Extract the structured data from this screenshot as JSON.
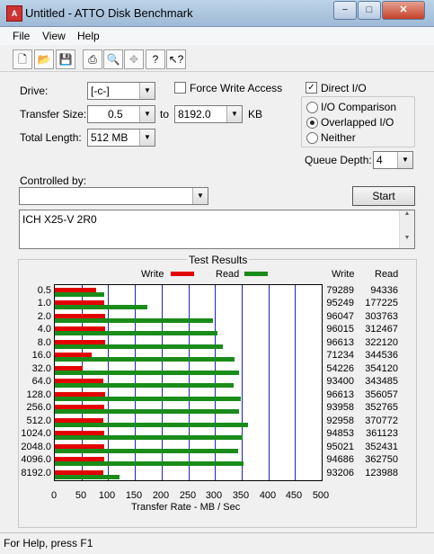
{
  "window": {
    "title": "Untitled - ATTO Disk Benchmark",
    "app_icon": "atto-app-icon",
    "controls": [
      "minimize-icon",
      "maximize-icon",
      "close-icon"
    ]
  },
  "menu": [
    "File",
    "View",
    "Help"
  ],
  "toolbar": [
    "new-icon",
    "open-icon",
    "save-icon",
    "print-icon",
    "print-preview-icon",
    "move-icon",
    "help-icon",
    "context-help-icon"
  ],
  "form": {
    "drive_label": "Drive:",
    "drive_value": "[-c-]",
    "force_write_label": "Force Write Access",
    "force_write_checked": false,
    "direct_io_label": "Direct I/O",
    "direct_io_checked": true,
    "transfer_size_label": "Transfer Size:",
    "transfer_from": "0.5",
    "transfer_to_label": "to",
    "transfer_to": "8192.0",
    "transfer_unit": "KB",
    "total_length_label": "Total Length:",
    "total_length_value": "512 MB",
    "io_options": [
      "I/O Comparison",
      "Overlapped I/O",
      "Neither"
    ],
    "io_selected": "Overlapped I/O",
    "queue_depth_label": "Queue Depth:",
    "queue_depth_value": "4",
    "controlled_by_label": "Controlled by:",
    "controlled_by_value": "",
    "start_label": "Start",
    "description": "ICH X25-V 2R0"
  },
  "results": {
    "title": "Test Results",
    "legend_write": "Write",
    "legend_read": "Read",
    "col_write": "Write",
    "col_read": "Read",
    "xlabel": "Transfer Rate - MB / Sec",
    "colors": {
      "write": "#e20000",
      "read": "#1a8c1a",
      "grid": "#1a24b8"
    }
  },
  "chart_data": {
    "type": "bar",
    "title": "Test Results",
    "xlabel": "Transfer Rate - MB / Sec",
    "ylabel": "",
    "xlim": [
      0,
      500
    ],
    "xticks": [
      "0",
      "50",
      "100",
      "150",
      "200",
      "250",
      "300",
      "350",
      "400",
      "450",
      "500"
    ],
    "categories": [
      "0.5",
      "1.0",
      "2.0",
      "4.0",
      "8.0",
      "16.0",
      "32.0",
      "64.0",
      "128.0",
      "256.0",
      "512.0",
      "1024.0",
      "2048.0",
      "4096.0",
      "8192.0"
    ],
    "series": [
      {
        "name": "Write",
        "values": [
          79289,
          95249,
          96047,
          96015,
          96613,
          71234,
          54226,
          93400,
          96613,
          93958,
          92958,
          94853,
          95021,
          94686,
          93206
        ]
      },
      {
        "name": "Read",
        "values": [
          94336,
          177225,
          303763,
          312467,
          322120,
          344536,
          354120,
          343485,
          356057,
          352765,
          370772,
          361123,
          352431,
          362750,
          123988
        ]
      }
    ]
  },
  "statusbar": "For Help, press F1"
}
